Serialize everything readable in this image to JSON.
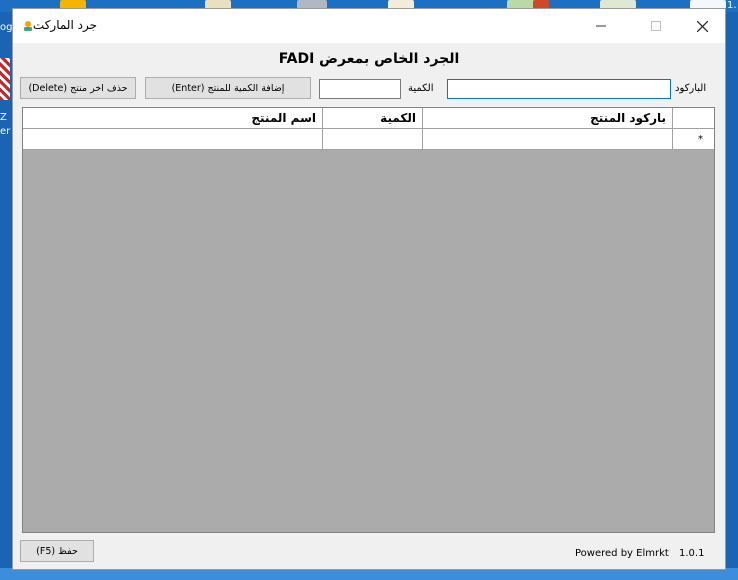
{
  "window": {
    "title": "جرد الماركت"
  },
  "heading": "الجرد الخاص بمعرض FADI",
  "form": {
    "barcode_label": "الباركود",
    "barcode_value": "",
    "quantity_label": "الكمية",
    "quantity_value": "",
    "add_button": "إضافة الكمية للمنتج (Enter)",
    "delete_button": "حذف اخر منتج (Delete)"
  },
  "grid": {
    "columns": [
      "باركود المنتج",
      "الكمية",
      "اسم المنتج"
    ],
    "new_row_marker": "*",
    "rows": []
  },
  "footer": {
    "save_button": "حفظ (F5)",
    "powered_by": "Powered by Elmrkt",
    "version": "1.0.1"
  },
  "desktop": {
    "edge_text_top": "og",
    "edge_text_right": "1.",
    "edge_text_side_1": "Z",
    "edge_text_side_2": "er"
  },
  "colors": {
    "accent": "#0078d7",
    "grid_background": "#ababab"
  }
}
